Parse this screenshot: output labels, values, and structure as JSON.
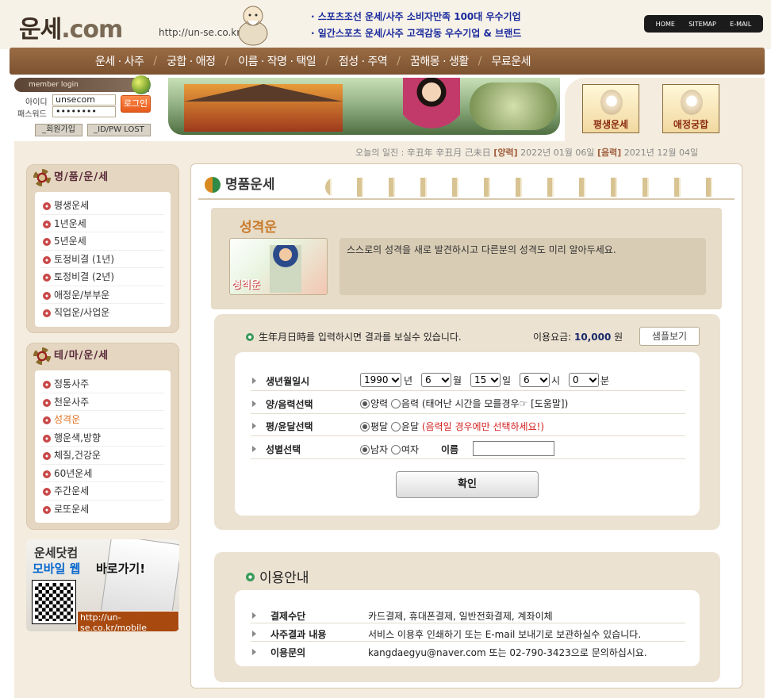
{
  "header": {
    "logo_main": "운세",
    "logo_dot": ".com",
    "site_url": "http://un-se.co.kr",
    "headlines": [
      "· 스포츠조선 운세/사주 소비자만족 100대 우수기업",
      "· 일간스포츠 운세/사주 고객감동 우수기업 & 브랜드"
    ],
    "top_nav": [
      "HOME",
      "SITEMAP",
      "E-MAIL"
    ]
  },
  "main_menu": [
    "운세 · 사주",
    "궁합 · 애정",
    "이름 · 작명 · 택일",
    "점성 · 주역",
    "꿈해몽 · 생활",
    "무료운세"
  ],
  "login": {
    "header": "member login",
    "id_label": "아이디",
    "pw_label": "패스워드",
    "id_value": "unsecom",
    "pw_value": "••••••••",
    "login_button": "로그인",
    "join_button": "_회원가입",
    "lost_button": "_ID/PW LOST"
  },
  "quick_tiles": [
    "평생운세",
    "애정궁합"
  ],
  "today": {
    "prefix": "오늘의 일진 : 辛丑年 辛丑月 己未日 ",
    "solar_label": "[양력]",
    "solar_date": " 2022년 01월 06일 ",
    "lunar_label": "[음력]",
    "lunar_date": " 2021년 12월 04일"
  },
  "sidebar": {
    "premium": {
      "title": "명/품/운/세",
      "items": [
        "평생운세",
        "1년운세",
        "5년운세",
        "토정비결 (1년)",
        "토정비결 (2년)",
        "애정운/부부운",
        "직업운/사업운"
      ]
    },
    "theme": {
      "title": "테/마/운/세",
      "items": [
        "정통사주",
        "천운사주",
        "성격운",
        "행운색,방향",
        "체질,건강운",
        "60년운세",
        "주간운세",
        "로또운세"
      ],
      "active_index": 2
    },
    "mobile": {
      "line1": "운세닷컴",
      "line2": "모바일 웹",
      "line3": "바로가기!",
      "url": "http://un-se.co.kr/mobile"
    }
  },
  "content": {
    "section_title": "명품운세",
    "topic_title": "성격운",
    "topic_image_label": "성격운",
    "topic_desc": "스스로의 성격을 새로 발견하시고 다른분의 성격도 미리 알아두세요.",
    "form_info": "生年月日時를 입력하시면 결과를 보실수 있습니다.",
    "fee_label": "이용요금: ",
    "fee_value": "10,000",
    "fee_unit": " 원",
    "sample_button": "샘플보기",
    "rows": {
      "birth": {
        "label": "생년월일시",
        "year": "1990",
        "year_unit": "년",
        "month": "6",
        "month_unit": "월",
        "day": "15",
        "day_unit": "일",
        "hour": "6",
        "hour_unit": "시",
        "minute": "0",
        "minute_unit": "분"
      },
      "calendar": {
        "label": "양/음력선택",
        "solar": "양력",
        "lunar": "음력",
        "note": " (태어난 시간을 모를경우☞ [도움말])"
      },
      "leap": {
        "label": "평/윤달선택",
        "normal": "평달",
        "leap": "윤달",
        "note": " (음력일 경우에만 선택하세요!)"
      },
      "gender": {
        "label": "성별선택",
        "male": "남자",
        "female": "여자",
        "name_label": "이름",
        "name_value": ""
      }
    },
    "confirm_button": "확인",
    "guide": {
      "title": "이용안내",
      "rows": [
        {
          "label": "결제수단",
          "value": "카드결제, 휴대폰결제, 일반전화결제, 계좌이체"
        },
        {
          "label": "사주결과 내용",
          "value": "서비스 이용후 인쇄하기 또는 E-mail 보내기로 보관하실수 있습니다."
        },
        {
          "label": "이용문의",
          "value": "kangdaegyu@naver.com 또는 02-790-3423으로 문의하십시요."
        }
      ]
    }
  }
}
